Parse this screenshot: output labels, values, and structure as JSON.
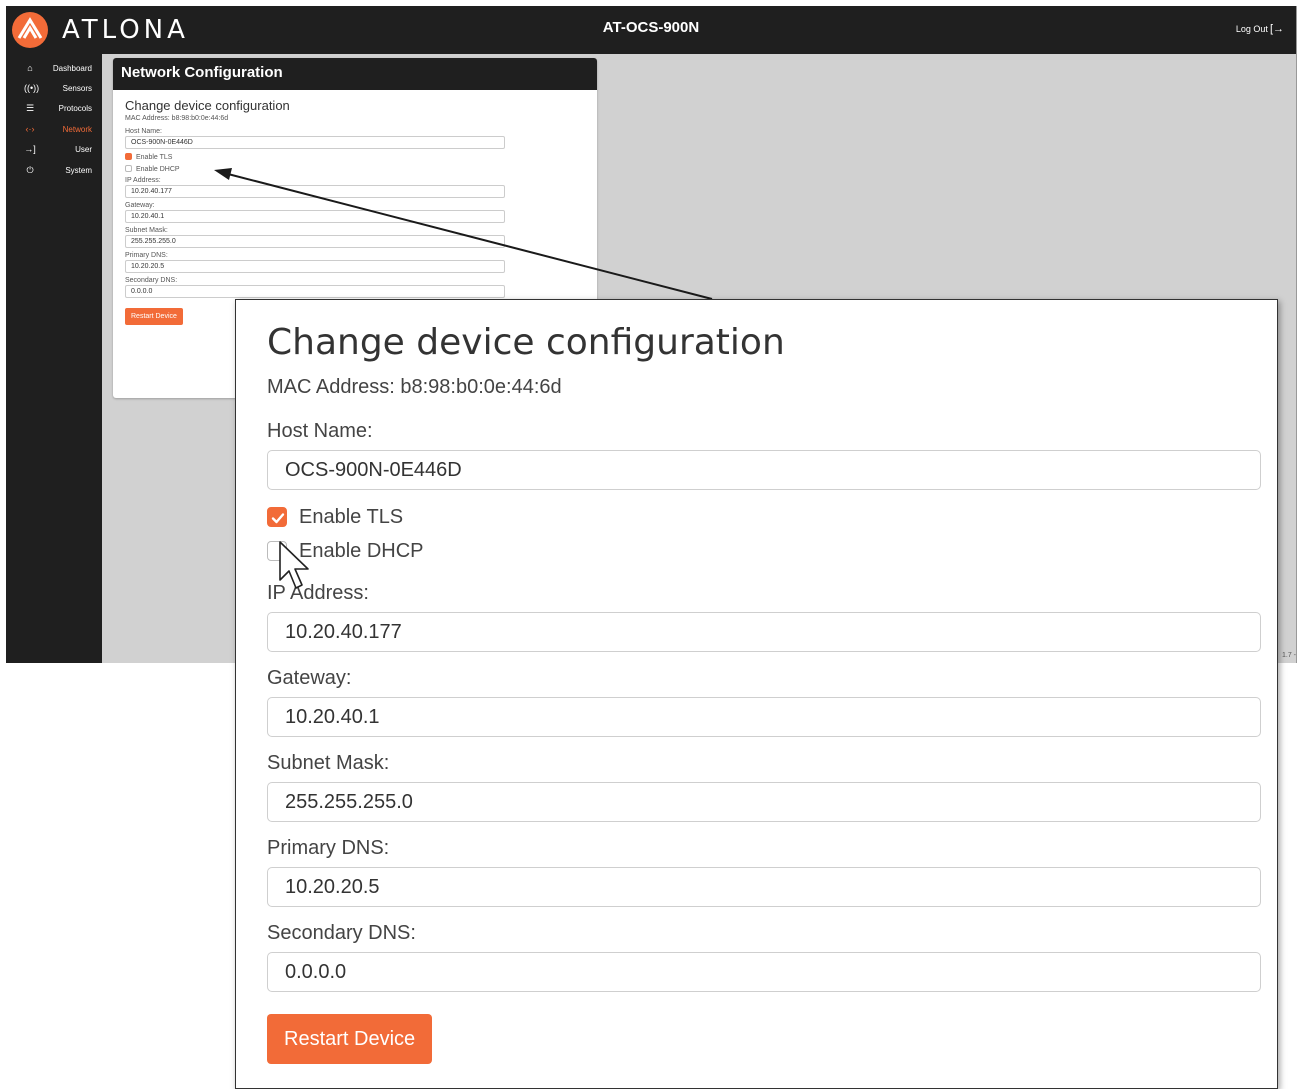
{
  "app": {
    "brand": "ATLONA",
    "device_name": "AT-OCS-900N",
    "logout_label": "Log Out",
    "version_fragment": "1.7 -"
  },
  "sidebar": {
    "items": [
      {
        "label": "Dashboard",
        "icon": "home-icon",
        "active": false
      },
      {
        "label": "Sensors",
        "icon": "sensor-icon",
        "active": false
      },
      {
        "label": "Protocols",
        "icon": "protocols-icon",
        "active": false
      },
      {
        "label": "Network",
        "icon": "network-icon",
        "active": true
      },
      {
        "label": "User",
        "icon": "login-icon",
        "active": false
      },
      {
        "label": "System",
        "icon": "plug-icon",
        "active": false
      }
    ]
  },
  "panel": {
    "title": "Network Configuration",
    "heading": "Change device configuration",
    "mac": "MAC Address: b8:98:b0:0e:44:6d",
    "host_label": "Host Name:",
    "host_value": "OCS-900N-0E446D",
    "tls_label": "Enable TLS",
    "tls_checked": true,
    "dhcp_label": "Enable DHCP",
    "dhcp_checked": false,
    "ip_label": "IP Address:",
    "ip_value": "10.20.40.177",
    "gateway_label": "Gateway:",
    "gateway_value": "10.20.40.1",
    "subnet_label": "Subnet Mask:",
    "subnet_value": "255.255.255.0",
    "pdns_label": "Primary DNS:",
    "pdns_value": "10.20.20.5",
    "sdns_label": "Secondary DNS:",
    "sdns_value": "0.0.0.0",
    "restart_label": "Restart Device"
  },
  "colors": {
    "accent": "#f26b38",
    "topbar": "#1f1f1f",
    "background": "#d1d1d1"
  }
}
